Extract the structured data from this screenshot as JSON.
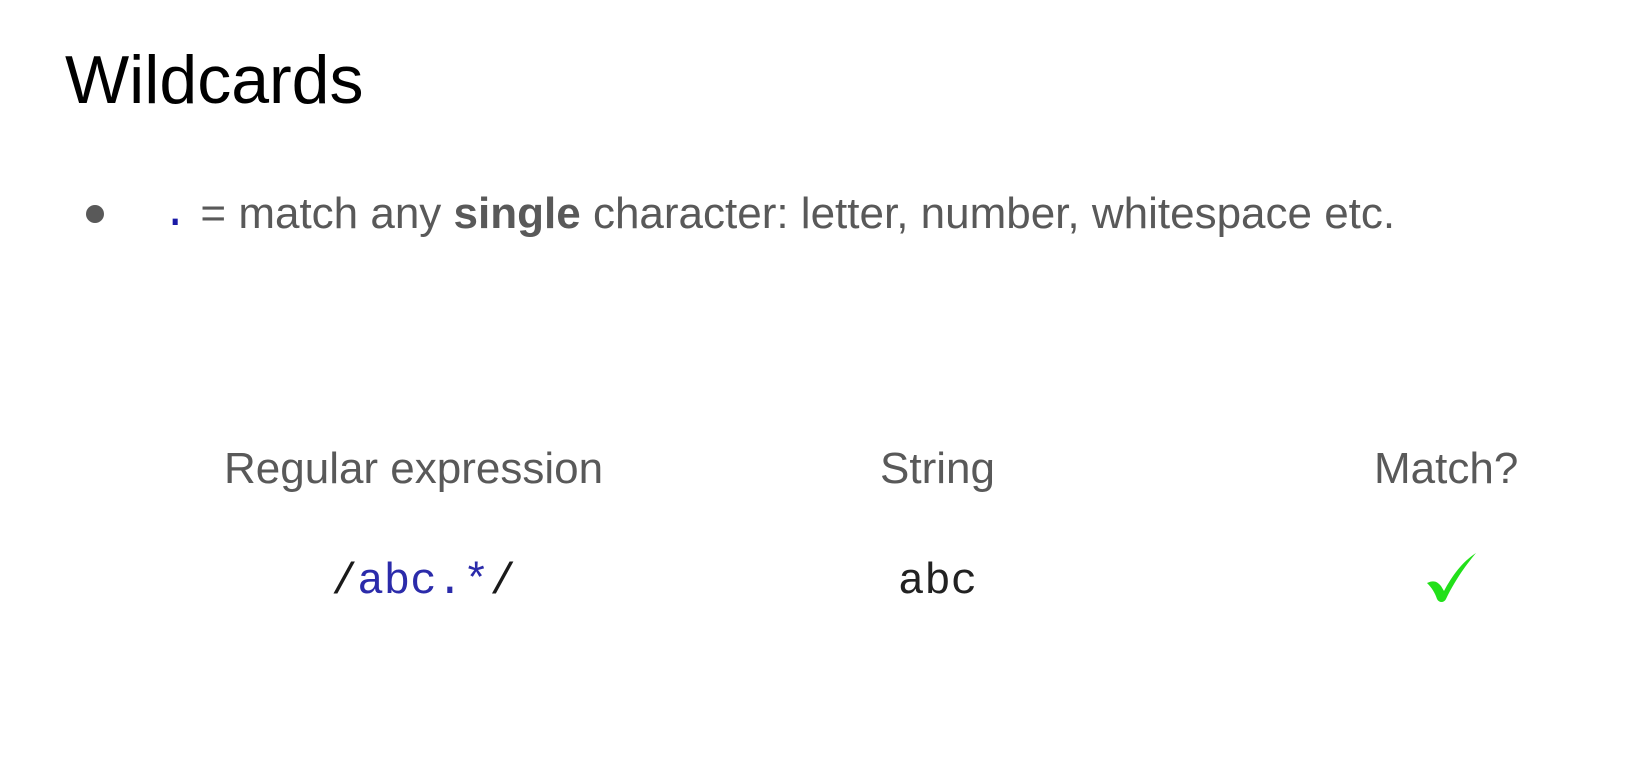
{
  "title": "Wildcards",
  "bullet": {
    "code": ".",
    "text_before": "= match any",
    "bold": "single",
    "text_after": "character: letter, number, whitespace etc."
  },
  "table": {
    "headers": [
      "Regular expression",
      "String",
      "Match?"
    ],
    "rows": [
      {
        "regex_open": "/",
        "regex_body": "abc.*",
        "regex_close": "/",
        "string": "abc",
        "match_icon": "green-checkmark-icon"
      }
    ]
  },
  "colors": {
    "check": "#22e01a",
    "code_blue": "#2b2baa",
    "body_text": "#595959"
  }
}
